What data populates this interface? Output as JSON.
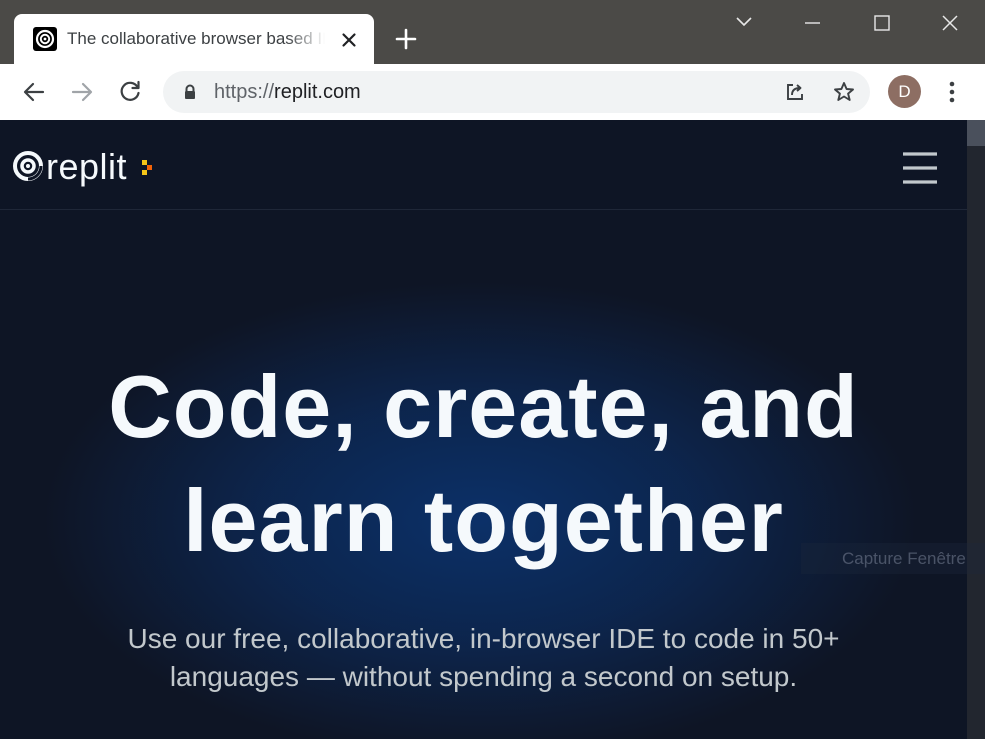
{
  "browser": {
    "tab": {
      "title": "The collaborative browser based IDE"
    },
    "address": {
      "scheme": "https://",
      "host": "replit.com"
    },
    "profile": {
      "initial": "D"
    }
  },
  "page": {
    "logo": {
      "text": "replit"
    },
    "hero": {
      "title_line1": "Code, create, and",
      "title_line2": "learn together",
      "subtitle_line1": "Use our free, collaborative, in-browser IDE to code in 50+",
      "subtitle_line2": "languages — without spending a second on setup."
    }
  },
  "overlay": {
    "watermark": "Capture Fenêtre"
  },
  "icons": {
    "tab_favicon": "replit-favicon-icon",
    "tab_close": "close-icon",
    "new_tab": "plus-icon",
    "tab_search": "chevron-down-icon",
    "minimize": "minimize-icon",
    "maximize": "maximize-icon",
    "close_window": "close-icon",
    "back": "arrow-left-icon",
    "forward": "arrow-right-icon",
    "reload": "reload-icon",
    "lock": "lock-icon",
    "share": "share-icon",
    "bookmark": "star-icon",
    "menu": "kebab-menu-icon",
    "hamburger": "hamburger-menu-icon"
  },
  "colors": {
    "page_bg": "#0e1525",
    "accent_orange": "#f26207",
    "accent_yellow": "#f5c518",
    "titlebar": "#4b4a47"
  }
}
